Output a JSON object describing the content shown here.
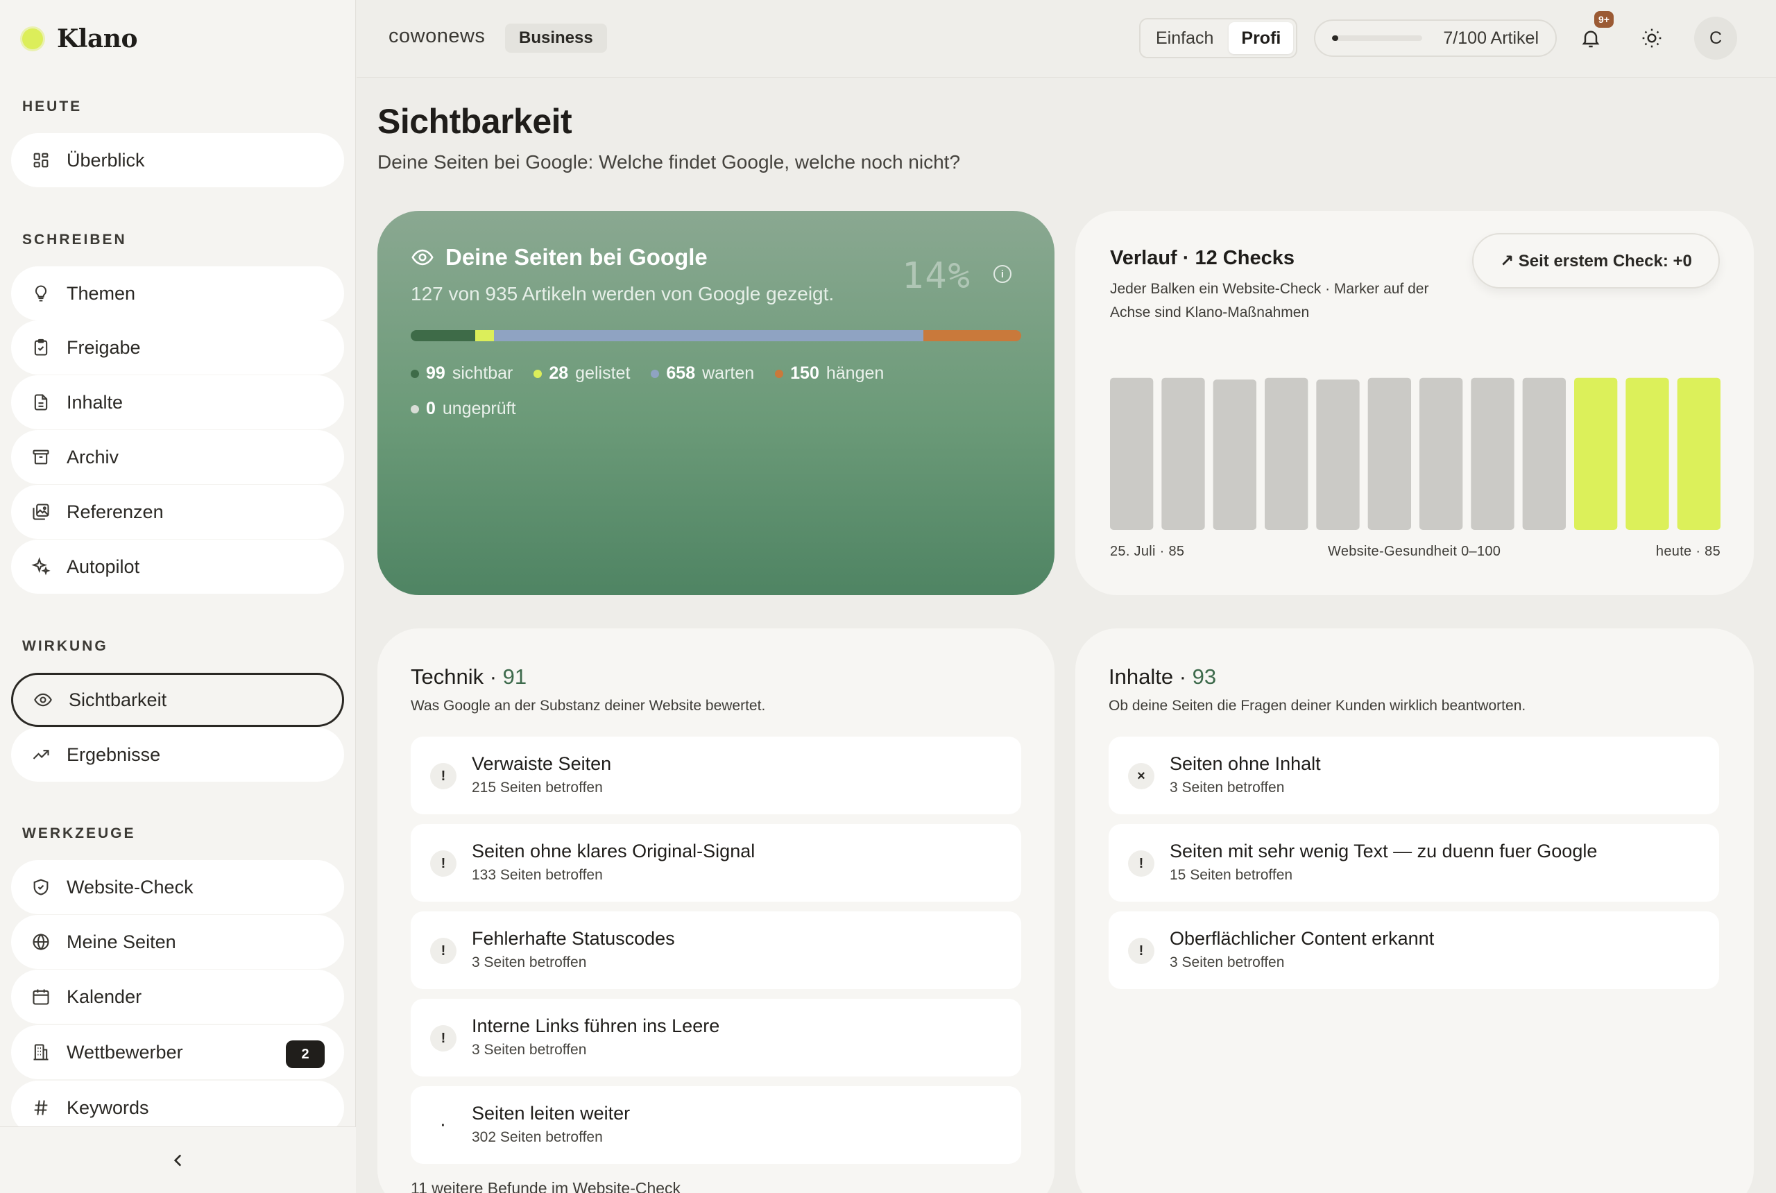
{
  "brand": {
    "name": "Klano",
    "accent": "#dcee5a"
  },
  "sidebar": {
    "sections": [
      {
        "title": "HEUTE",
        "items": [
          {
            "label": "Überblick",
            "icon": "grid-icon"
          }
        ]
      },
      {
        "title": "SCHREIBEN",
        "items": [
          {
            "label": "Themen",
            "icon": "lightbulb-icon"
          },
          {
            "label": "Freigabe",
            "icon": "clipboard-check-icon"
          },
          {
            "label": "Inhalte",
            "icon": "document-icon"
          },
          {
            "label": "Archiv",
            "icon": "archive-icon"
          },
          {
            "label": "Referenzen",
            "icon": "image-gallery-icon"
          },
          {
            "label": "Autopilot",
            "icon": "sparkle-icon"
          }
        ]
      },
      {
        "title": "WIRKUNG",
        "items": [
          {
            "label": "Sichtbarkeit",
            "icon": "eye-icon",
            "active": true
          },
          {
            "label": "Ergebnisse",
            "icon": "trend-up-icon"
          }
        ]
      },
      {
        "title": "WERKZEUGE",
        "items": [
          {
            "label": "Website-Check",
            "icon": "shield-icon"
          },
          {
            "label": "Meine Seiten",
            "icon": "globe-icon"
          },
          {
            "label": "Kalender",
            "icon": "calendar-icon"
          },
          {
            "label": "Wettbewerber",
            "icon": "building-icon",
            "badge": "2"
          },
          {
            "label": "Keywords",
            "icon": "hash-icon"
          }
        ]
      }
    ]
  },
  "topbar": {
    "workspace": "cowonews",
    "plan": "Business",
    "modes": [
      {
        "label": "Einfach",
        "active": false
      },
      {
        "label": "Profi",
        "active": true
      }
    ],
    "quota": {
      "text": "7/100 Artikel",
      "fraction": 0.07
    },
    "notifications_badge": "9+",
    "avatar_initial": "C"
  },
  "page": {
    "title": "Sichtbarkeit",
    "subtitle": "Deine Seiten bei Google: Welche findet Google, welche noch nicht?"
  },
  "hero": {
    "title": "Deine Seiten bei Google",
    "subtitle": "127 von 935 Artikeln werden von Google gezeigt.",
    "percent": "14%",
    "info": "i",
    "segments": [
      {
        "count": "99",
        "value": 99,
        "label": "sichtbar",
        "color": "#3e6b48"
      },
      {
        "count": "28",
        "value": 28,
        "label": "gelistet",
        "color": "#dcee5a"
      },
      {
        "count": "658",
        "value": 658,
        "label": "warten",
        "color": "#8fa3c2"
      },
      {
        "count": "150",
        "value": 150,
        "label": "hängen",
        "color": "#c9793b"
      },
      {
        "count": "0",
        "value": 0,
        "label": "ungeprüft",
        "color": "#d8ddd6"
      }
    ]
  },
  "trend": {
    "title": "Verlauf · 12 Checks",
    "description": "Jeder Balken ein Website-Check · Marker auf der Achse sind Klano-Maßnahmen",
    "button": "↗ Seit erstem Check: +0",
    "axis_left": "25. Juli · 85",
    "axis_mid": "Website-Gesundheit 0–100",
    "axis_right": "heute · 85"
  },
  "chart_data": {
    "type": "bar",
    "values": [
      85,
      85,
      84,
      85,
      84,
      85,
      85,
      85,
      85,
      85,
      85,
      85
    ],
    "highlight_from_index": 9,
    "ylim": [
      0,
      100
    ],
    "colors": {
      "default": "#cbcac6",
      "highlight": "#dcf05a"
    }
  },
  "technik": {
    "title": "Technik",
    "score": "91",
    "description": "Was Google an der Substanz deiner Website bewertet.",
    "issues": [
      {
        "icon": "!",
        "title": "Verwaiste Seiten",
        "meta": "215 Seiten betroffen"
      },
      {
        "icon": "!",
        "title": "Seiten ohne klares Original-Signal",
        "meta": "133 Seiten betroffen"
      },
      {
        "icon": "!",
        "title": "Fehlerhafte Statuscodes",
        "meta": "3 Seiten betroffen"
      },
      {
        "icon": "!",
        "title": "Interne Links führen ins Leere",
        "meta": "3 Seiten betroffen"
      },
      {
        "icon": "·",
        "title": "Seiten leiten weiter",
        "meta": "302 Seiten betroffen"
      }
    ],
    "more": "11 weitere Befunde im Website-Check"
  },
  "inhalte": {
    "title": "Inhalte",
    "score": "93",
    "description": "Ob deine Seiten die Fragen deiner Kunden wirklich beantworten.",
    "issues": [
      {
        "icon": "×",
        "title": "Seiten ohne Inhalt",
        "meta": "3 Seiten betroffen"
      },
      {
        "icon": "!",
        "title": "Seiten mit sehr wenig Text — zu duenn fuer Google",
        "meta": "15 Seiten betroffen"
      },
      {
        "icon": "!",
        "title": "Oberflächlicher Content erkannt",
        "meta": "3 Seiten betroffen"
      }
    ]
  }
}
